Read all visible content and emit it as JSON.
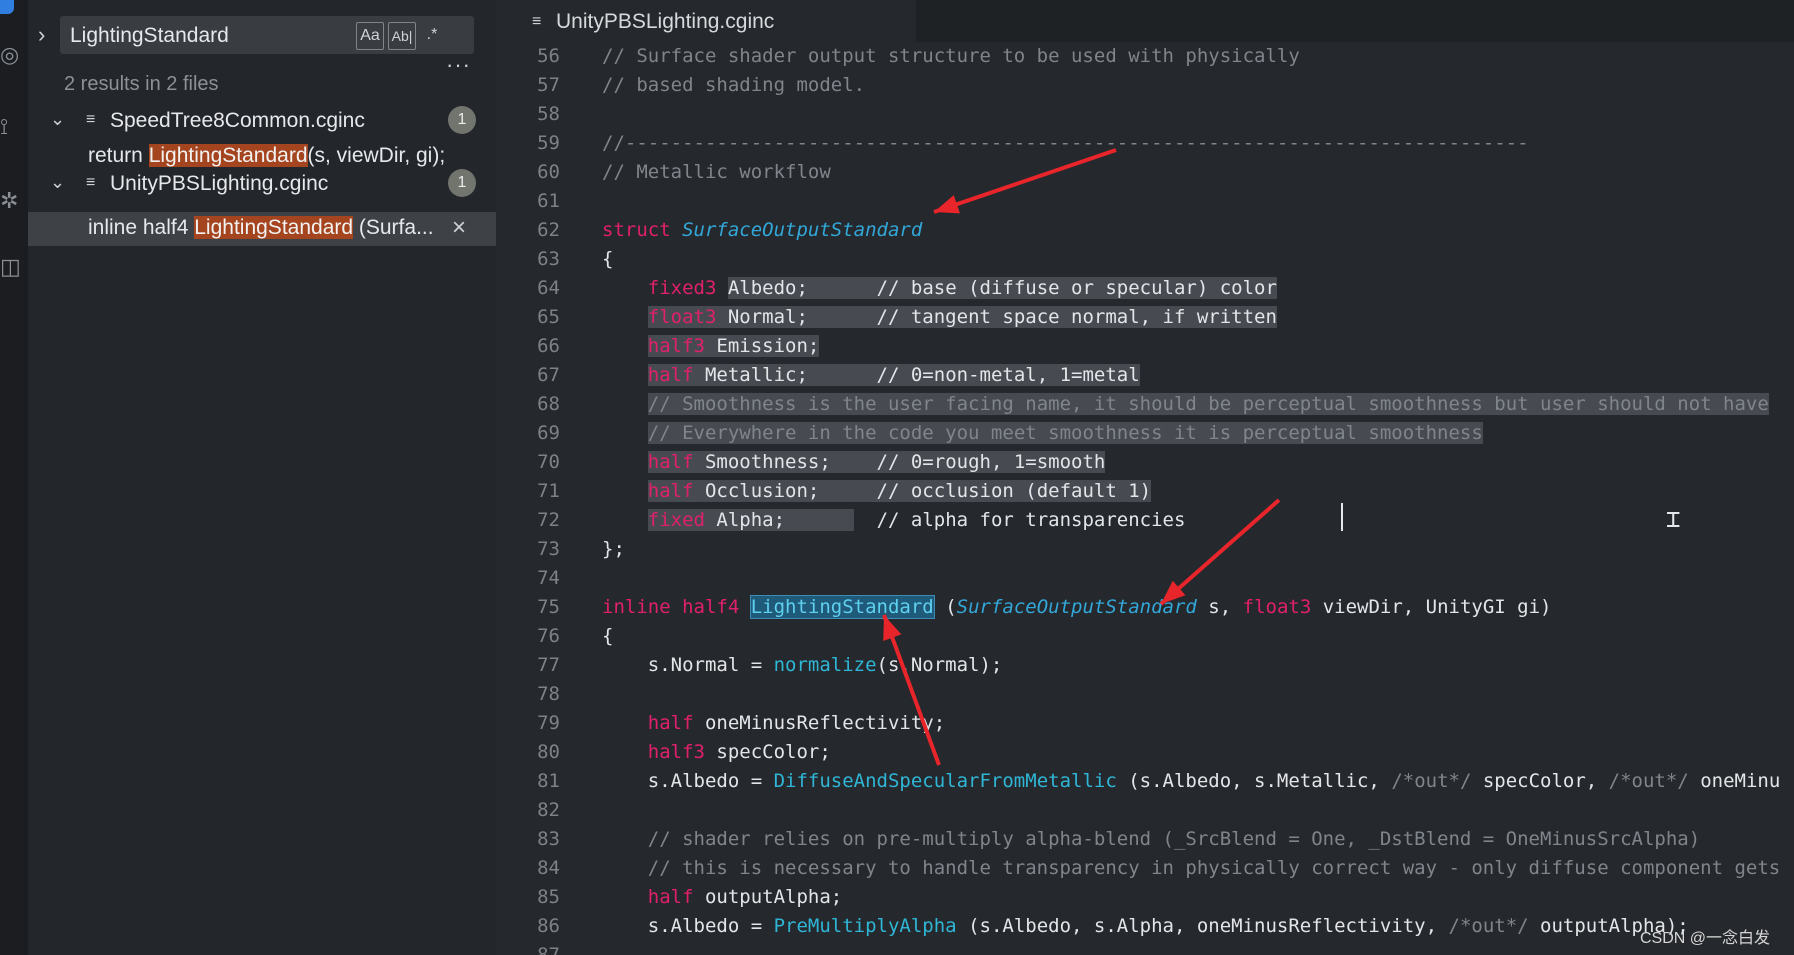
{
  "search": {
    "query": "LightingStandard",
    "match_case_label": "Aa",
    "whole_word_label": "Ab|",
    "regex_label": ".*",
    "results_summary": "2 results in 2 files",
    "more_label": "···"
  },
  "results": [
    {
      "file": "SpeedTree8Common.cginc",
      "count": "1",
      "match": {
        "before": "return ",
        "hit": "LightingStandard",
        "after": "(s, viewDir, gi);"
      }
    },
    {
      "file": "UnityPBSLighting.cginc",
      "count": "1",
      "match": {
        "before": "inline half4 ",
        "hit": "LightingStandard",
        "after": " (Surfa..."
      }
    }
  ],
  "editor": {
    "tab_title": "UnityPBSLighting.cginc",
    "lines": [
      {
        "n": "56",
        "segs": [
          {
            "t": "// Surface shader output structure to be used with physically",
            "c": "c"
          }
        ]
      },
      {
        "n": "57",
        "segs": [
          {
            "t": "// based shading model.",
            "c": "c"
          }
        ]
      },
      {
        "n": "58",
        "segs": []
      },
      {
        "n": "59",
        "segs": [
          {
            "t": "//-------------------------------------------------------------------------------",
            "c": "c"
          }
        ]
      },
      {
        "n": "60",
        "segs": [
          {
            "t": "// Metallic workflow",
            "c": "c"
          }
        ]
      },
      {
        "n": "61",
        "segs": []
      },
      {
        "n": "62",
        "segs": [
          {
            "t": "struct ",
            "c": "t"
          },
          {
            "t": "SurfaceOutputStandard",
            "c": "ty"
          }
        ]
      },
      {
        "n": "63",
        "segs": [
          {
            "t": "{",
            "c": "p"
          }
        ]
      },
      {
        "n": "64",
        "segs": [
          {
            "t": "    ",
            "c": "p"
          },
          {
            "t": "fixed3",
            "c": "t"
          },
          {
            "t": " ",
            "c": "p"
          },
          {
            "t": "Albedo;      // base (diffuse or specular) color",
            "c": "p s"
          }
        ]
      },
      {
        "n": "65",
        "segs": [
          {
            "t": "    ",
            "c": "p"
          },
          {
            "t": "float3",
            "c": "t s"
          },
          {
            "t": " Normal;      // tangent space normal, if written",
            "c": "p s"
          }
        ]
      },
      {
        "n": "66",
        "segs": [
          {
            "t": "    ",
            "c": "p"
          },
          {
            "t": "half3",
            "c": "t s"
          },
          {
            "t": " Emission;",
            "c": "p s"
          }
        ]
      },
      {
        "n": "67",
        "segs": [
          {
            "t": "    ",
            "c": "p"
          },
          {
            "t": "half",
            "c": "t s"
          },
          {
            "t": " Metallic;      // 0=non-metal, 1=metal",
            "c": "p s"
          }
        ]
      },
      {
        "n": "68",
        "segs": [
          {
            "t": "    ",
            "c": "p"
          },
          {
            "t": "// Smoothness is the user facing name, it should be perceptual smoothness but user should not have",
            "c": "c s"
          }
        ]
      },
      {
        "n": "69",
        "segs": [
          {
            "t": "    ",
            "c": "p"
          },
          {
            "t": "// Everywhere in the code you meet smoothness it is perceptual smoothness",
            "c": "c s"
          }
        ]
      },
      {
        "n": "70",
        "segs": [
          {
            "t": "    ",
            "c": "p"
          },
          {
            "t": "half",
            "c": "t s"
          },
          {
            "t": " Smoothness;    // 0=rough, 1=smooth",
            "c": "p s"
          }
        ]
      },
      {
        "n": "71",
        "segs": [
          {
            "t": "    ",
            "c": "p"
          },
          {
            "t": "half",
            "c": "t s"
          },
          {
            "t": " Occlusion;     // occlusion (default 1)",
            "c": "p s"
          }
        ]
      },
      {
        "n": "72",
        "segs": [
          {
            "t": "    ",
            "c": "p"
          },
          {
            "t": "fixed",
            "c": "t s"
          },
          {
            "t": " Alpha;      ",
            "c": "p s"
          },
          {
            "t": "  // alpha for transparencies",
            "c": "p"
          }
        ]
      },
      {
        "n": "73",
        "segs": [
          {
            "t": "};",
            "c": "p"
          }
        ]
      },
      {
        "n": "74",
        "segs": []
      },
      {
        "n": "75",
        "segs": [
          {
            "t": "inline half4 ",
            "c": "t"
          },
          {
            "t": "LightingStandard",
            "c": "hlw"
          },
          {
            "t": " (",
            "c": "p"
          },
          {
            "t": "SurfaceOutputStandard",
            "c": "ty"
          },
          {
            "t": " s, ",
            "c": "p"
          },
          {
            "t": "float3",
            "c": "t"
          },
          {
            "t": " viewDir, UnityGI gi)",
            "c": "p"
          }
        ]
      },
      {
        "n": "76",
        "segs": [
          {
            "t": "{",
            "c": "p"
          }
        ]
      },
      {
        "n": "77",
        "segs": [
          {
            "t": "    s.Normal = ",
            "c": "p"
          },
          {
            "t": "normalize",
            "c": "f"
          },
          {
            "t": "(s.Normal);",
            "c": "p"
          }
        ]
      },
      {
        "n": "78",
        "segs": []
      },
      {
        "n": "79",
        "segs": [
          {
            "t": "    ",
            "c": "p"
          },
          {
            "t": "half",
            "c": "t"
          },
          {
            "t": " oneMinusReflectivity;",
            "c": "p"
          }
        ]
      },
      {
        "n": "80",
        "segs": [
          {
            "t": "    ",
            "c": "p"
          },
          {
            "t": "half3",
            "c": "t"
          },
          {
            "t": " specColor;",
            "c": "p"
          }
        ]
      },
      {
        "n": "81",
        "segs": [
          {
            "t": "    s.Albedo = ",
            "c": "p"
          },
          {
            "t": "DiffuseAndSpecularFromMetallic",
            "c": "f"
          },
          {
            "t": " (s.Albedo, s.Metallic, ",
            "c": "p"
          },
          {
            "t": "/*out*/",
            "c": "c"
          },
          {
            "t": " specColor, ",
            "c": "p"
          },
          {
            "t": "/*out*/",
            "c": "c"
          },
          {
            "t": " oneMinu",
            "c": "p"
          }
        ]
      },
      {
        "n": "82",
        "segs": []
      },
      {
        "n": "83",
        "segs": [
          {
            "t": "    // shader relies on pre-multiply alpha-blend (_SrcBlend = One, _DstBlend = OneMinusSrcAlpha)",
            "c": "c"
          }
        ]
      },
      {
        "n": "84",
        "segs": [
          {
            "t": "    // this is necessary to handle transparency in physically correct way - only diffuse component gets",
            "c": "c"
          }
        ]
      },
      {
        "n": "85",
        "segs": [
          {
            "t": "    ",
            "c": "p"
          },
          {
            "t": "half",
            "c": "t"
          },
          {
            "t": " outputAlpha;",
            "c": "p"
          }
        ]
      },
      {
        "n": "86",
        "segs": [
          {
            "t": "    s.Albedo = ",
            "c": "p"
          },
          {
            "t": "PreMultiplyAlpha",
            "c": "f"
          },
          {
            "t": " (s.Albedo, s.Alpha, oneMinusReflectivity, ",
            "c": "p"
          },
          {
            "t": "/*out*/",
            "c": "c"
          },
          {
            "t": " outputAlpha);",
            "c": "p"
          }
        ]
      },
      {
        "n": "87",
        "segs": []
      }
    ]
  },
  "watermark": "CSDN @一念白发",
  "colors": {
    "arrow": "#e8252b",
    "match_highlight": "#a5451f",
    "keyword": "#e0206c",
    "type": "#32a7d8"
  }
}
